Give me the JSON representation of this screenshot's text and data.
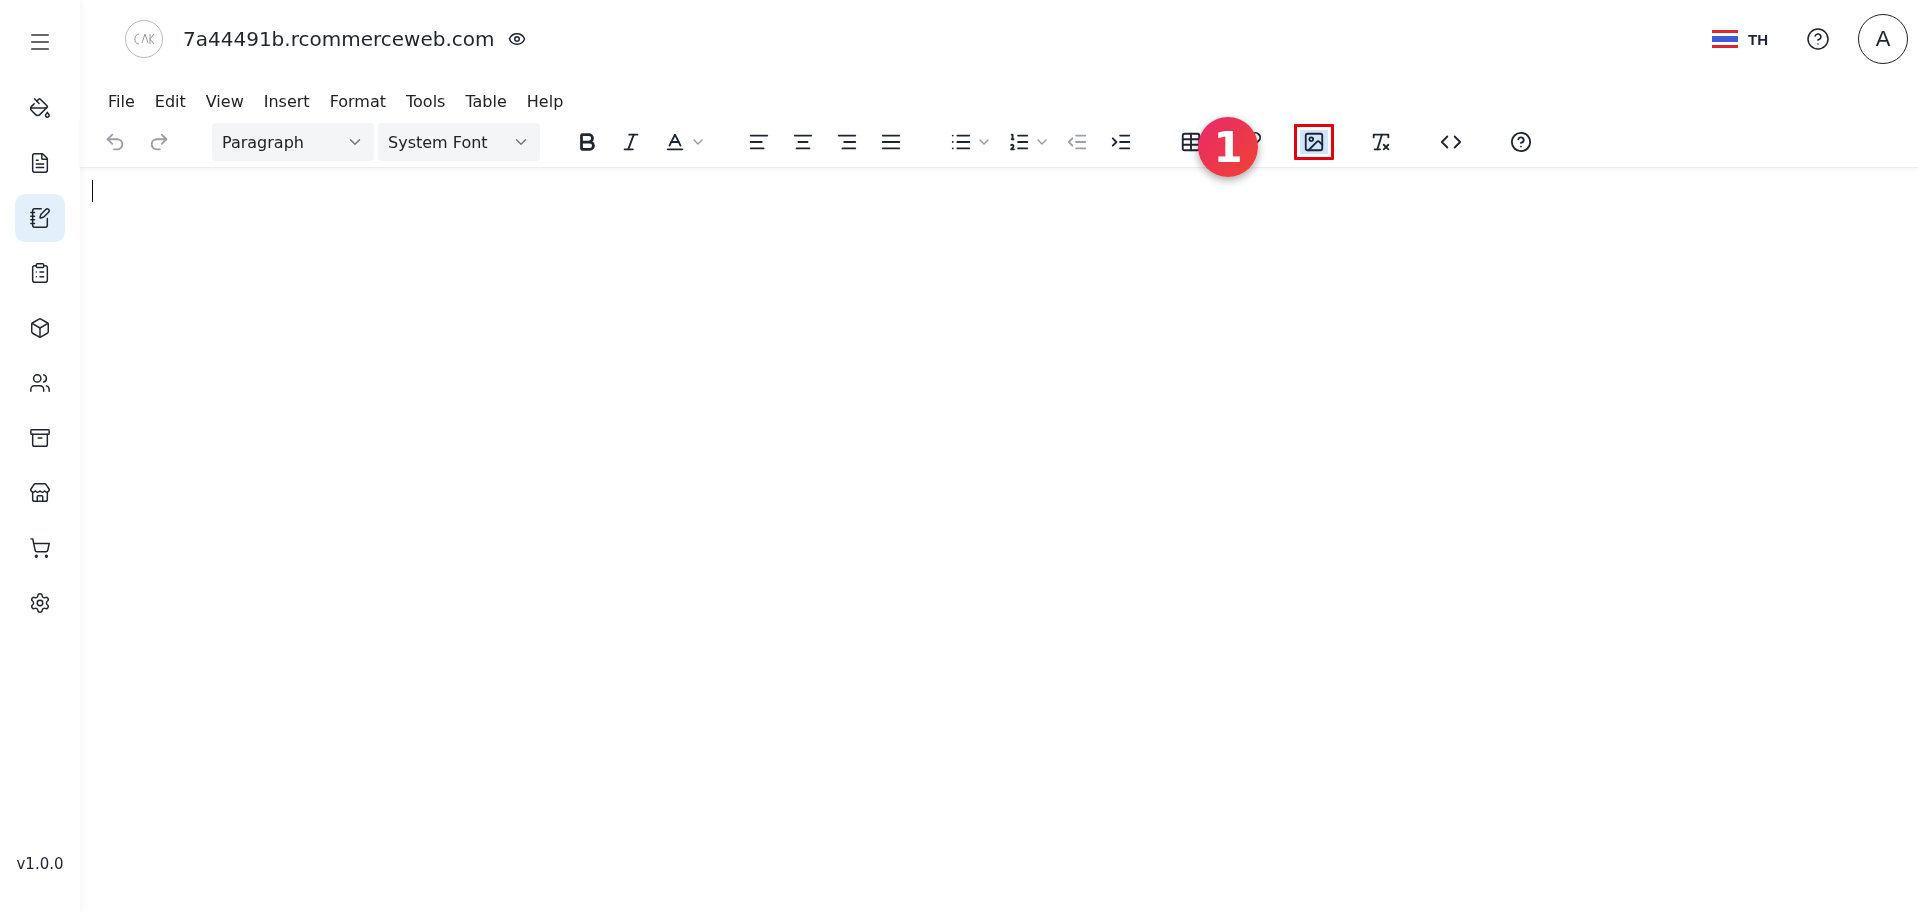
{
  "topbar": {
    "site": "7a44491b.rcommerceweb.com",
    "language": "TH",
    "avatar": "A"
  },
  "sidebar": {
    "items": [
      {
        "selected": false
      },
      {
        "selected": false
      },
      {
        "selected": true
      },
      {
        "selected": false
      },
      {
        "selected": false
      },
      {
        "selected": false
      },
      {
        "selected": false
      },
      {
        "selected": false
      },
      {
        "selected": false
      },
      {
        "selected": false
      }
    ],
    "version": "v1.0.0"
  },
  "menubar": [
    "File",
    "Edit",
    "View",
    "Insert",
    "Format",
    "Tools",
    "Table",
    "Help"
  ],
  "toolbar": [
    {
      "items": [
        {
          "kind": "button",
          "disabled": true
        },
        {
          "kind": "button",
          "disabled": true
        }
      ]
    },
    {
      "items": [
        {
          "kind": "select",
          "value": "Paragraph"
        },
        {
          "kind": "select",
          "value": "System Font"
        }
      ]
    },
    {
      "items": [
        {
          "kind": "button",
          "disabled": false
        },
        {
          "kind": "button",
          "disabled": false
        },
        {
          "kind": "split",
          "disabled": false
        }
      ]
    },
    {
      "items": [
        {
          "kind": "button",
          "disabled": false
        },
        {
          "kind": "button",
          "disabled": false
        },
        {
          "kind": "button",
          "disabled": false
        },
        {
          "kind": "button",
          "disabled": false
        }
      ]
    },
    {
      "items": [
        {
          "kind": "split",
          "disabled": false
        },
        {
          "kind": "split",
          "disabled": false
        },
        {
          "kind": "button",
          "disabled": true
        },
        {
          "kind": "button",
          "disabled": false
        }
      ]
    },
    {
      "items": [
        {
          "kind": "button",
          "disabled": false
        },
        {
          "kind": "button",
          "disabled": false
        },
        {
          "kind": "button",
          "disabled": false,
          "selected": true,
          "highlighted": true
        }
      ]
    },
    {
      "items": [
        {
          "kind": "button",
          "disabled": false
        }
      ]
    },
    {
      "items": [
        {
          "kind": "button",
          "disabled": false
        }
      ]
    },
    {
      "items": [
        {
          "kind": "button",
          "disabled": false
        }
      ]
    }
  ],
  "step_badge": "1"
}
